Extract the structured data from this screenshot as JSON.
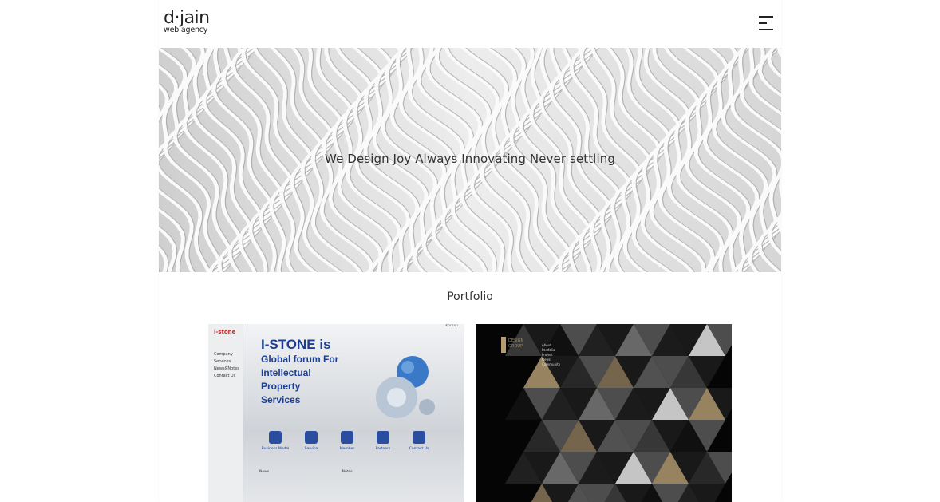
{
  "header": {
    "logo_main": "d·jain",
    "logo_sub": "web agency",
    "menu_icon": "hamburger-menu-icon"
  },
  "hero": {
    "tagline": "We Design Joy Always Innovating Never settling"
  },
  "portfolio": {
    "title": "Portfolio",
    "items": [
      {
        "name": "I-STONE",
        "preview": {
          "logo": "i-stone",
          "lang": "Korean",
          "nav": [
            "Company",
            "Services",
            "News&Notes",
            "Contact Us"
          ],
          "headline_1": "I-STONE is",
          "headline_2": "Global forum For",
          "headline_3": "Intellectual",
          "headline_4": "Property",
          "headline_5": "Services",
          "icons": [
            "Business Model",
            "Service",
            "Member",
            "Partners",
            "Contact Us"
          ],
          "news_label": "News",
          "notes_label": "Notes"
        }
      },
      {
        "name": "Design Group",
        "preview": {
          "brand_1": "DESIGN",
          "brand_2": "GROUP",
          "menu": [
            "About",
            "Portfolio",
            "Project",
            "News",
            "Community"
          ]
        }
      }
    ]
  },
  "colors": {
    "text": "#333333",
    "istone_blue": "#1c3f91",
    "gold": "#b89c6f"
  }
}
